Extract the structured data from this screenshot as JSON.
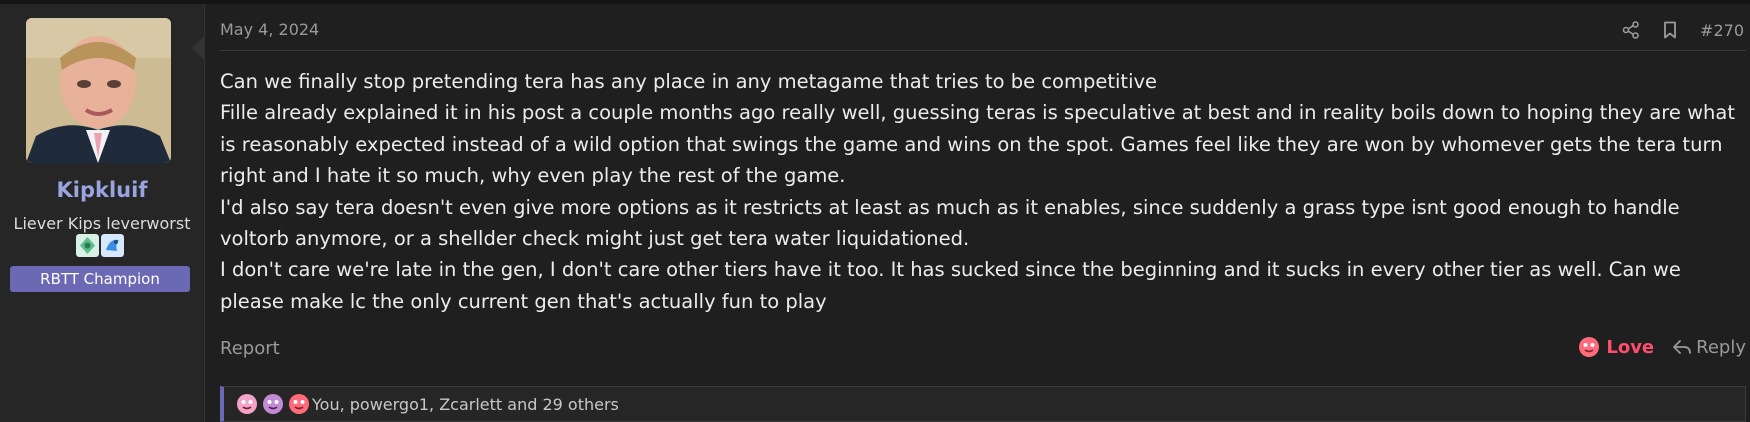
{
  "user": {
    "name": "Kipkluif",
    "title": "Liever Kips leverworst",
    "banner": "RBTT Champion",
    "badges": [
      "grass-crest-badge",
      "water-crest-badge"
    ]
  },
  "post": {
    "date": "May 4, 2024",
    "number": "#270",
    "paragraphs": [
      "Can we finally stop pretending tera has any place in any metagame that tries to be competitive",
      "Fille already explained it in his post a couple months ago really well, guessing teras is speculative at best and in reality boils down to hoping they are what is reasonably expected instead of a wild option that swings the game and wins on the spot. Games feel like they are won by whomever gets the tera turn right and I hate it so much, why even play the rest of the game.",
      "I'd also say tera doesn't even give more options as it restricts at least as much as it enables, since suddenly a grass type isnt good enough to handle voltorb anymore, or a shellder check might just get tera water liquidationed.",
      "I don't care we're late in the gen, I don't care other tiers have it too. It has sucked since the beginning and it sucks in every other tier as well. Can we please make lc the only current gen that's actually fun to play"
    ]
  },
  "actions": {
    "report": "Report",
    "love": "Love",
    "reply": "Reply"
  },
  "reactions": {
    "summary": "You, powergo1, Zcarlett and 29 others",
    "icons": [
      "love-reaction-icon",
      "love-reaction-icon",
      "love-reaction-icon"
    ]
  },
  "colors": {
    "accent": "#6b69b4",
    "username": "#9aa4e0",
    "love": "#ff4d6d",
    "background": "#1f1f1f",
    "sidebar": "#262626"
  }
}
